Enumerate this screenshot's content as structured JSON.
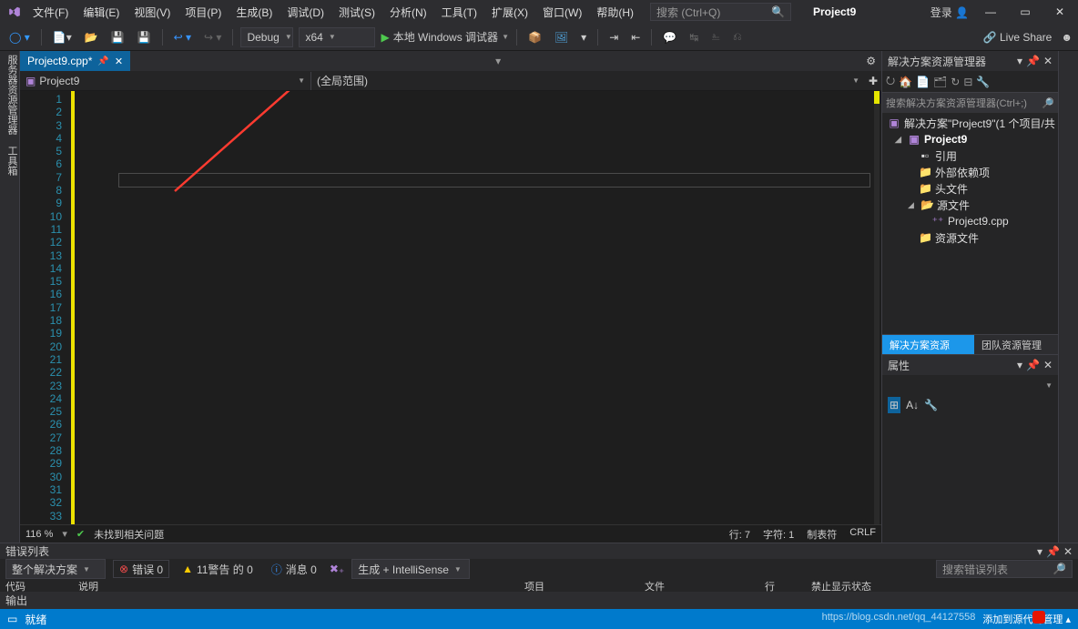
{
  "menu": {
    "items": [
      "文件(F)",
      "编辑(E)",
      "视图(V)",
      "项目(P)",
      "生成(B)",
      "调试(D)",
      "测试(S)",
      "分析(N)",
      "工具(T)",
      "扩展(X)",
      "窗口(W)",
      "帮助(H)"
    ]
  },
  "search": {
    "placeholder": "搜索 (Ctrl+Q)"
  },
  "project_title": "Project9",
  "login": "登录",
  "toolbar": {
    "config": "Debug",
    "platform": "x64",
    "run_label": "本地 Windows 调试器",
    "live_share": "Live Share"
  },
  "tab": {
    "name": "Project9.cpp*"
  },
  "nav": {
    "scope": "Project9",
    "member": "(全局范围)"
  },
  "editor": {
    "line_count": 33
  },
  "editor_status": {
    "zoom": "116 %",
    "issues": "未找到相关问题",
    "line": "行: 7",
    "col": "字符: 1",
    "tab": "制表符",
    "eol": "CRLF"
  },
  "solution_explorer": {
    "title": "解决方案资源管理器",
    "search_placeholder": "搜索解决方案资源管理器(Ctrl+;)",
    "solution": "解决方案\"Project9\"(1 个项目/共",
    "project": "Project9",
    "nodes": {
      "refs": "引用",
      "ext": "外部依赖项",
      "headers": "头文件",
      "sources": "源文件",
      "file": "Project9.cpp",
      "res": "资源文件"
    },
    "tabs": {
      "active": "解决方案资源管...",
      "other": "团队资源管理器"
    }
  },
  "properties": {
    "title": "属性"
  },
  "error_list": {
    "title": "错误列表",
    "scope": "整个解决方案",
    "errors": "错误 0",
    "warnings": "11警告 的 0",
    "messages": "消息 0",
    "filter": "生成 + IntelliSense",
    "search_placeholder": "搜索错误列表",
    "cols": {
      "code": "代码",
      "desc": "说明",
      "project": "项目",
      "file": "文件",
      "line": "行",
      "suppress": "禁止显示状态"
    }
  },
  "output": {
    "title": "输出"
  },
  "statusbar": {
    "ready": "就绪",
    "watermark": "https://blog.csdn.net/qq_44127558",
    "src_ctrl": "添加到源代码管理"
  },
  "left_rail": "服务器资源管理器  工具箱"
}
